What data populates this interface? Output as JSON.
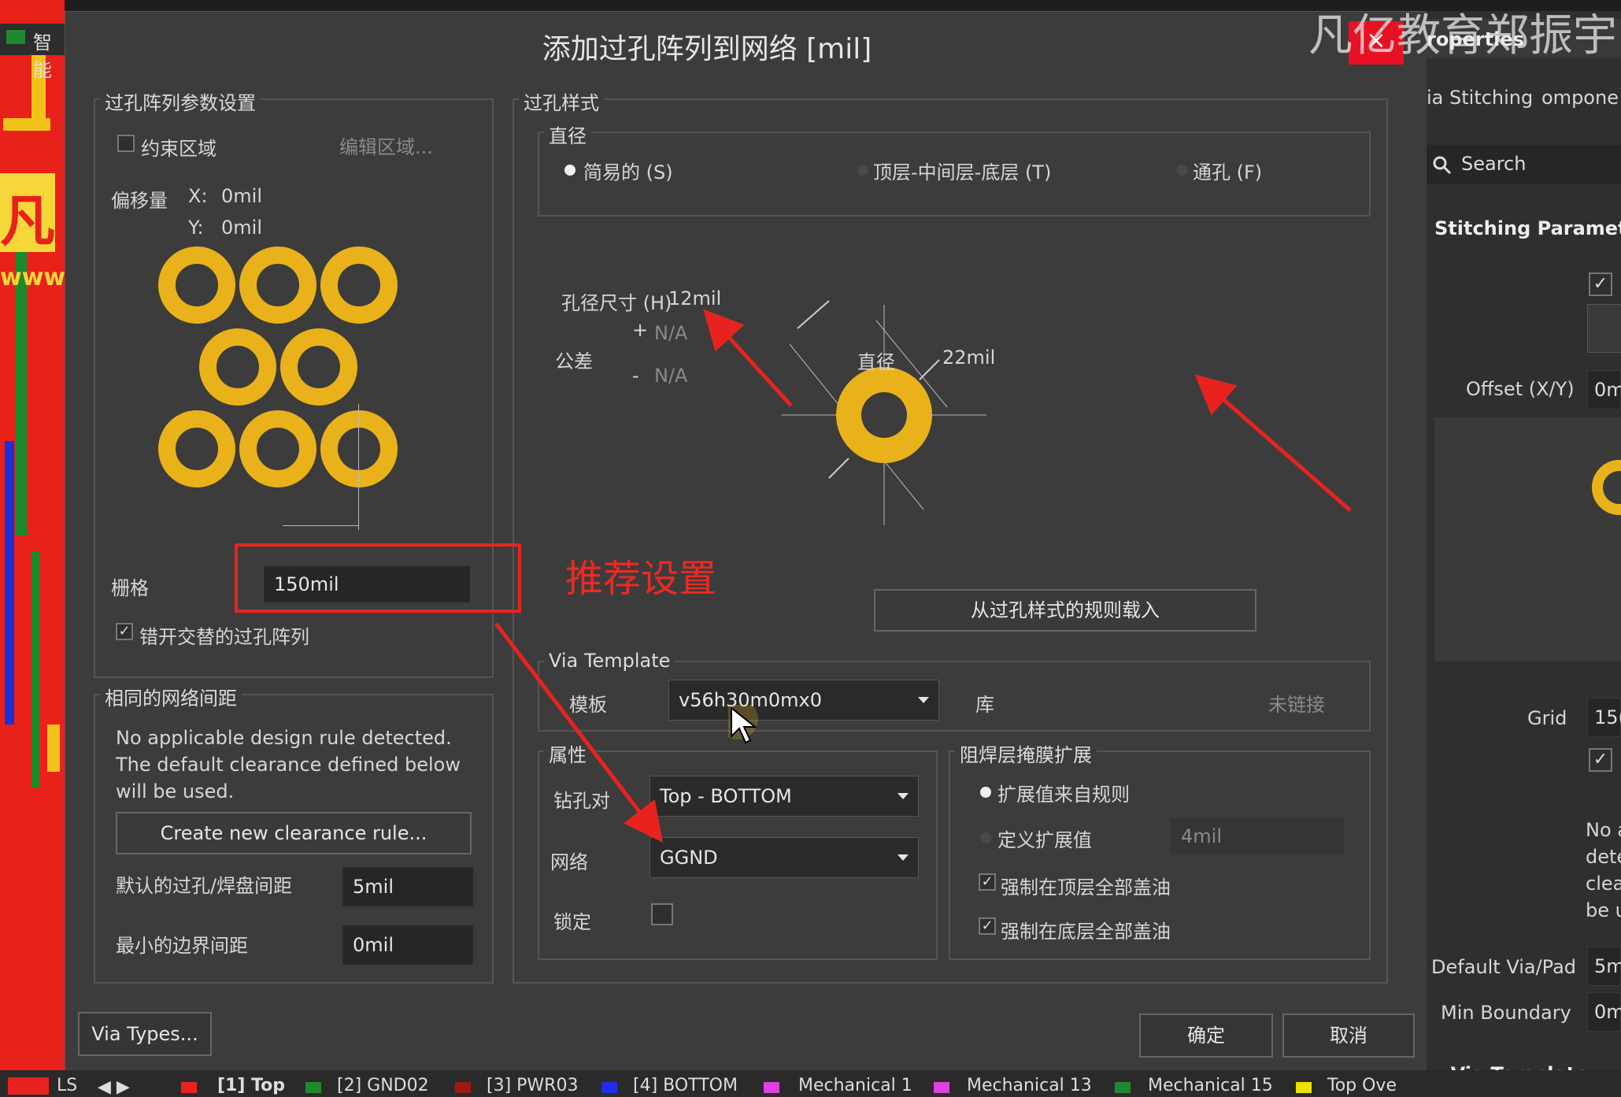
{
  "watermark": "凡亿教育郑振宇",
  "background": {
    "left_tab": "智能",
    "pcb_texts": [
      "凡",
      "www."
    ]
  },
  "dialog": {
    "title": "添加过孔阵列到网络 [mil]",
    "close_label": "×",
    "array_params": {
      "title": "过孔阵列参数设置",
      "constrain_area_label": "约束区域",
      "edit_area_label": "编辑区域...",
      "offset_label": "偏移量",
      "offset_x_label": "X:",
      "offset_x_value": "0mil",
      "offset_y_label": "Y:",
      "offset_y_value": "0mil",
      "grid_label": "栅格",
      "grid_value": "150mil",
      "stagger_label": "错开交替的过孔阵列",
      "stagger_checked": true
    },
    "clearance": {
      "title": "相同的网络间距",
      "message_line1": "No applicable design rule detected.",
      "message_line2": "The default clearance defined below",
      "message_line3": "will be used.",
      "create_rule_button": "Create new clearance rule...",
      "default_via_pad_label": "默认的过孔/焊盘间距",
      "default_via_pad_value": "5mil",
      "min_boundary_label": "最小的边界间距",
      "min_boundary_value": "0mil"
    },
    "via_style": {
      "title": "过孔样式",
      "diameter_group_title": "直径",
      "radio_simple": "简易的 (S)",
      "radio_top_mid_bottom": "顶层-中间层-底层 (T)",
      "radio_through": "通孔 (F)",
      "selected": "simple",
      "hole_size_label": "孔径尺寸 (H)",
      "hole_size_value": "12mil",
      "tolerance_label": "公差",
      "tol_plus_sign": "+",
      "tol_plus_value": "N/A",
      "tol_minus_sign": "-",
      "tol_minus_value": "N/A",
      "diameter_label": "直径",
      "diameter_value": "22mil",
      "load_from_rule_button": "从过孔样式的规则载入"
    },
    "via_template": {
      "title": "Via Template",
      "template_label": "模板",
      "template_value": "v56h30m0mx0",
      "library_label": "库",
      "library_status": "未链接"
    },
    "properties": {
      "title": "属性",
      "drill_pair_label": "钻孔对",
      "drill_pair_value": "Top - BOTTOM",
      "net_label": "网络",
      "net_value": "GGND",
      "lock_label": "锁定",
      "lock_checked": false
    },
    "solder_mask": {
      "title": "阻焊层掩膜扩展",
      "radio_from_rule": "扩展值来自规则",
      "radio_define": "定义扩展值",
      "define_value": "4mil",
      "selected": "from_rule",
      "tent_top_label": "强制在顶层全部盖油",
      "tent_top_checked": true,
      "tent_bottom_label": "强制在底层全部盖油",
      "tent_bottom_checked": true
    },
    "via_types_button": "Via Types...",
    "ok_button": "确定",
    "cancel_button": "取消"
  },
  "annotation": {
    "recommend_text": "推荐设置",
    "color": "#e8231f"
  },
  "properties_panel": {
    "title": "roperties",
    "tab1": "ia Stitching",
    "tab2": "ompone",
    "search_placeholder": "Search",
    "section_title": "Stitching Parameter",
    "offset_label": "Offset (X/Y)",
    "offset_value": "0m",
    "grid_label": "Grid",
    "grid_value": "15(",
    "note_lines": [
      "No a",
      "dete",
      "clea",
      "be u"
    ],
    "default_via_pad_label": "Default Via/Pad",
    "default_via_pad_value": "5m",
    "min_boundary_label": "Min Boundary",
    "min_boundary_value": "0m",
    "via_template_section": "Via Template"
  },
  "layer_tabs": [
    {
      "label": "LS",
      "color": "#2a2a2a"
    },
    {
      "label": "[1] Top",
      "color": "#e8231f"
    },
    {
      "label": "[2] GND02",
      "color": "#1e8a30"
    },
    {
      "label": "[3] PWR03",
      "color": "#a01818"
    },
    {
      "label": "[4] BOTTOM",
      "color": "#1e2fe8"
    },
    {
      "label": "Mechanical 1",
      "color": "#e040e0"
    },
    {
      "label": "Mechanical 13",
      "color": "#e040e0"
    },
    {
      "label": "Mechanical 15",
      "color": "#1e8a30"
    },
    {
      "label": "Top Ove",
      "color": "#f0e000"
    }
  ]
}
